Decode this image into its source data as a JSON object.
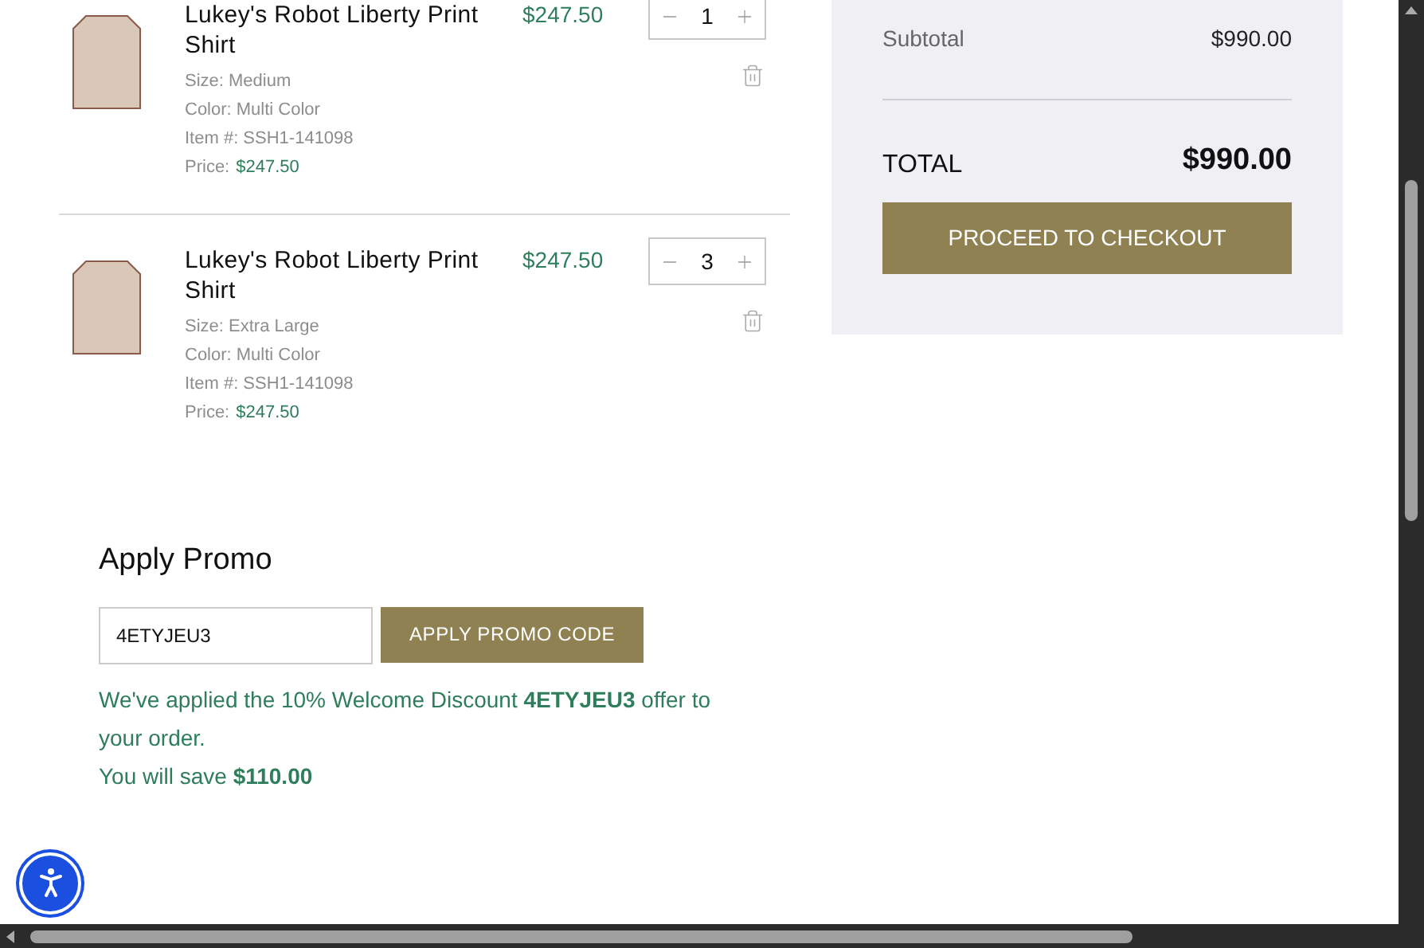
{
  "cart_items": [
    {
      "title": "Lukey's Robot Liberty Print Shirt",
      "size": "Size: Medium",
      "color_text": "Color: Multi Color",
      "item_number": "Item #: SSH1-141098",
      "price_label": "Price:",
      "price": "$247.50",
      "line_price": "$247.50",
      "quantity": "1"
    },
    {
      "title": "Lukey's Robot Liberty Print Shirt",
      "size": "Size: Extra Large",
      "color_text": "Color: Multi Color",
      "item_number": "Item #: SSH1-141098",
      "price_label": "Price:",
      "price": "$247.50",
      "line_price": "$247.50",
      "quantity": "3"
    }
  ],
  "promo": {
    "title": "Apply Promo",
    "code_value": "4ETYJEU3",
    "button": "APPLY PROMO CODE",
    "message": "We've applied the 10% Welcome Discount **4ETYJEU3** offer to your order.",
    "savings": "You will save **$110.00**"
  },
  "summary": {
    "subtotal_label": "Subtotal",
    "subtotal": "$990.00",
    "total_label": "TOTAL",
    "total": "$990.00",
    "checkout_button": "PROCEED TO CHECKOUT"
  }
}
